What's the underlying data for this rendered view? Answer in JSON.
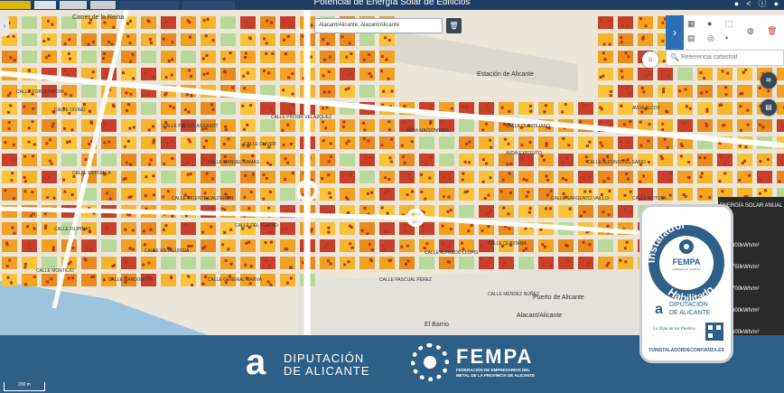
{
  "header": {
    "title": "Potencial de Energía Solar de Edificios"
  },
  "search": {
    "value": "Alacant/Alicante, Alacant/Alicante"
  },
  "cadastral": {
    "placeholder": "Referencia catastral"
  },
  "legend": {
    "title": "ENERGÍA SOLAR ANUAL",
    "entries": [
      "800kWh/m²",
      "750kWh/m²",
      "700kWh/m²",
      "600kWh/m²",
      "500kWh/m²"
    ]
  },
  "map": {
    "streets": [
      "CALLE PORTA PAYOM",
      "CALLE DIVINO",
      "CALLE ESTRELLA",
      "CALLE FILIPINAS",
      "CALLE MONTEJO",
      "CALLE PINTOR AGRASOT",
      "CALLE MANUEL DAMAS",
      "CALLE VICENTE CALDERON",
      "CALLE OLIVER",
      "CALLE PINTOR VELÁZQUEZ",
      "AVDA MAISONNAVE",
      "AVDA EXPOSITO",
      "CALLE ALFONSO EL SABIO",
      "CALLE SARGENTO VAILLO",
      "CALLE QUINTANA",
      "CALLE ALFREDO LLÓPIS",
      "CALLE METALURGIA",
      "CALLE GARDUNOVA",
      "CALLE GENERAL MARVÁ",
      "CALLE PASCUAL PÉREZ",
      "CALLE MÉNDEZ NÚÑEZ",
      "CALLE QUINTILIANO",
      "AVDA ALCOY",
      "CALLE ROTOVA",
      "CALLE DEL TEATRO"
    ],
    "places": [
      "Estación de Alicante",
      "Alacant/Alicante",
      "Puerto de Alicante",
      "El Barrio",
      "Carrer de la Reina"
    ],
    "scale": "200 m"
  },
  "banner": {
    "dipu_line1": "DIPUTACIÓN",
    "dipu_line2": "DE ALICANTE",
    "dipu_mark": "a",
    "fempa_name": "FEMPA",
    "fempa_sub1": "FEDERACIÓN DE EMPRESARIOS DEL",
    "fempa_sub2": "METAL DE LA PROVINCIA DE ALICANTE"
  },
  "badge": {
    "arc_top": "Instalador",
    "arc_bottom": "Habilitado",
    "fempa": "FEMPA",
    "fempa_tag": "instaladorcon confianza",
    "dipu1": "DIPUTACIÓN",
    "dipu2": "DE ALICANTE",
    "slogan": "La Dipu de los Pueblos",
    "url": "TUINSTALADORDECONFIANZA.ES"
  },
  "colors": {
    "header": "#1e3f62",
    "banner": "#2e5f86",
    "tool_accent": "#2d6fb6",
    "roof_high": "#f4a21f",
    "roof_mid": "#f9c43a",
    "roof_low": "#c8402a"
  },
  "icons": [
    "trash-icon",
    "chevron-right-icon",
    "building-icon",
    "layers-icon",
    "search-icon",
    "home-icon"
  ]
}
